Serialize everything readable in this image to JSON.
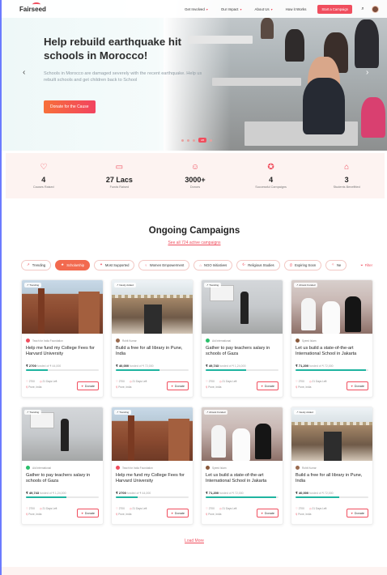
{
  "header": {
    "logo": "Fairseed",
    "nav": [
      "Get Involved",
      "Our Impact",
      "About Us",
      "How it Works"
    ],
    "nav_dropdown": [
      true,
      true,
      true,
      false
    ],
    "start_button": "Start a Campaign"
  },
  "hero": {
    "title": "Help rebuild earthquake hit schools in Morocco!",
    "description": "Schools in Morocco are damaged severely with the recent earthquake. Help us rebuilt schools and get children back to School",
    "cta": "Donate for the Cause",
    "slide_label": "4/6"
  },
  "stats": [
    {
      "icon": "hand-heart-icon",
      "value": "4",
      "label": "Causes Raised"
    },
    {
      "icon": "money-icon",
      "value": "27 Lacs",
      "label": "Funds Raised"
    },
    {
      "icon": "people-icon",
      "value": "3000+",
      "label": "Donors"
    },
    {
      "icon": "badge-icon",
      "value": "4",
      "label": "Successful Campaigns"
    },
    {
      "icon": "graduation-cap-icon",
      "value": "3",
      "label": "Students Benefitted"
    }
  ],
  "section": {
    "title": "Ongoing Campaigns",
    "link": "See all 724 active campaigns"
  },
  "filters": [
    {
      "label": "Trending",
      "active": false
    },
    {
      "label": "Scholarship",
      "active": true
    },
    {
      "label": "Most Supported",
      "active": false
    },
    {
      "label": "Women Empowerment",
      "active": false
    },
    {
      "label": "NGO Initiatives",
      "active": false
    },
    {
      "label": "Religious Studies",
      "active": false
    },
    {
      "label": "Expiring Soon",
      "active": false
    },
    {
      "label": "Ne",
      "active": false
    }
  ],
  "filter_button": "Filter",
  "campaigns": [
    {
      "tag": "Trending",
      "org": "Teach for India Foundation",
      "title": "Help me fund my College Fees for Harvard University",
      "raised": "₹ 2700",
      "goal": "funded of ₹ 44,000",
      "progress": 0.3,
      "donors": "2700",
      "days": "21 Days Left",
      "location": "Pune, India",
      "img": "building",
      "org_color": "#f04e5e"
    },
    {
      "tag": "Newly Added",
      "org": "Rohit Kumar",
      "title": "Build a free for all library in Pune, India",
      "raised": "₹ 40,000",
      "goal": "funded of ₹ 72,000",
      "progress": 0.6,
      "donors": "2700",
      "days": "21 Days Left",
      "location": "Pune, India",
      "img": "library",
      "org_color": "#9a6b4f"
    },
    {
      "tag": "Trending",
      "org": "Aid International",
      "title": "Gather to pay teachers salary in schools of Gaza",
      "raised": "₹ 49,743",
      "goal": "funded of ₹ 1,24,000",
      "progress": 0.55,
      "donors": "2700",
      "days": "21 Days Left",
      "location": "Pune, India",
      "img": "classroom",
      "org_color": "#2bbf6b"
    },
    {
      "tag": "Almost Funded",
      "org": "Syeed Islam",
      "title": "Let us build a state-of-the-art International School in Jakarta",
      "raised": "₹ 71,200",
      "goal": "funded of ₹ 72,000",
      "progress": 0.97,
      "donors": "2700",
      "days": "21 Days Left",
      "location": "Pune, India",
      "img": "girls",
      "org_color": "#8a5a3c"
    },
    {
      "tag": "Trending",
      "org": "Aid International",
      "title": "Gather to pay teachers salary in schools of Gaza",
      "raised": "₹ 49,743",
      "goal": "funded of ₹ 1,24,000",
      "progress": 0.55,
      "donors": "2700",
      "days": "21 Days Left",
      "location": "Pune, India",
      "img": "classroom",
      "org_color": "#2bbf6b"
    },
    {
      "tag": "Trending",
      "org": "Teach for India Foundation",
      "title": "Help me fund my College Fees for Harvard University",
      "raised": "₹ 2700",
      "goal": "funded of ₹ 44,000",
      "progress": 0.3,
      "donors": "2700",
      "days": "21 Days Left",
      "location": "Pune, India",
      "img": "building",
      "org_color": "#f04e5e"
    },
    {
      "tag": "Almost Funded",
      "org": "Syeed Islam",
      "title": "Let us build a state-of-the-art International School in Jakarta",
      "raised": "₹ 71,200",
      "goal": "funded of ₹ 72,000",
      "progress": 0.97,
      "donors": "2700",
      "days": "21 Days Left",
      "location": "Pune, India",
      "img": "girls",
      "org_color": "#8a5a3c"
    },
    {
      "tag": "Newly Added",
      "org": "Rohit Kumar",
      "title": "Build a free for all library in Pune, India",
      "raised": "₹ 40,000",
      "goal": "funded of ₹ 72,000",
      "progress": 0.6,
      "donors": "2700",
      "days": "21 Days Left",
      "location": "Pune, India",
      "img": "library",
      "org_color": "#9a6b4f"
    }
  ],
  "donate_label": "Donate",
  "load_more": "Load More"
}
